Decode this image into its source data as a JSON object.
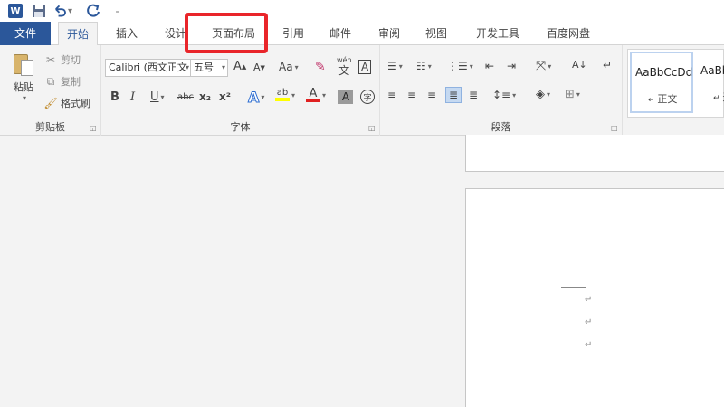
{
  "quick_access": {
    "word_logo": "W",
    "icons": [
      "word-logo-icon",
      "save-icon",
      "undo-icon",
      "redo-icon",
      "customize-icon"
    ]
  },
  "tabs": [
    {
      "id": "file",
      "label": "文件"
    },
    {
      "id": "home",
      "label": "开始"
    },
    {
      "id": "insert",
      "label": "插入"
    },
    {
      "id": "design",
      "label": "设计"
    },
    {
      "id": "layout",
      "label": "页面布局"
    },
    {
      "id": "references",
      "label": "引用"
    },
    {
      "id": "mailings",
      "label": "邮件"
    },
    {
      "id": "review",
      "label": "审阅"
    },
    {
      "id": "view",
      "label": "视图"
    },
    {
      "id": "developer",
      "label": "开发工具"
    },
    {
      "id": "baidu",
      "label": "百度网盘"
    }
  ],
  "clipboard": {
    "paste": "粘贴",
    "cut": "剪切",
    "copy": "复制",
    "format_painter": "格式刷",
    "group_label": "剪贴板"
  },
  "font": {
    "font_name": "Calibri (西文正文",
    "font_size": "五号",
    "change_case": "Aa",
    "phonetic_top": "wén",
    "phonetic_bottom": "文",
    "char_border": "A",
    "bold": "B",
    "italic": "I",
    "underline": "U",
    "strike": "abc",
    "subscript": "x₂",
    "superscript": "x²",
    "group_label": "字体"
  },
  "paragraph": {
    "group_label": "段落"
  },
  "styles": {
    "items": [
      {
        "preview": "AaBbCcDd",
        "name": "正文"
      },
      {
        "preview": "AaBbCcDd",
        "name": "无"
      }
    ]
  },
  "colors": {
    "word_blue": "#2b579a",
    "highlight_red": "#e9252a",
    "font_color": "#e02020",
    "highlight_yellow": "#ffff00"
  }
}
